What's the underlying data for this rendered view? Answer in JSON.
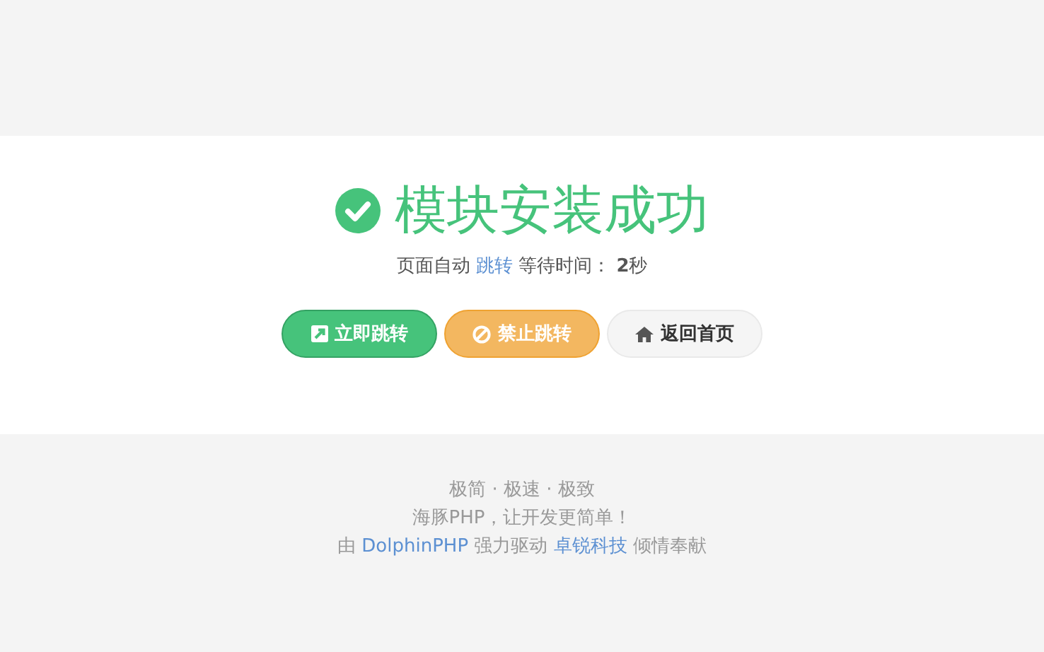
{
  "result": {
    "title": "模块安装成功"
  },
  "message": {
    "before": "页面自动",
    "link": "跳转",
    "after": "等待时间： **2**秒"
  },
  "buttons": [
    {
      "kind": "success",
      "label": "立即跳转"
    },
    {
      "kind": "warning",
      "label": "禁止跳转"
    },
    {
      "kind": "default",
      "label": "返回首页"
    }
  ],
  "footer": {
    "lines": [
      [
        {
          "kind": "text",
          "text": "极简 · 极速 · 极致"
        }
      ],
      [
        {
          "kind": "text",
          "text": "海豚PHP，让开发更简单！"
        }
      ],
      [
        {
          "kind": "text",
          "text": "由"
        },
        {
          "kind": "link",
          "text": "DolphinPHP"
        },
        {
          "kind": "text",
          "text": "强力驱动"
        },
        {
          "kind": "link",
          "text": "卓锐科技"
        },
        {
          "kind": "text",
          "text": "倾情奉献"
        }
      ]
    ]
  }
}
